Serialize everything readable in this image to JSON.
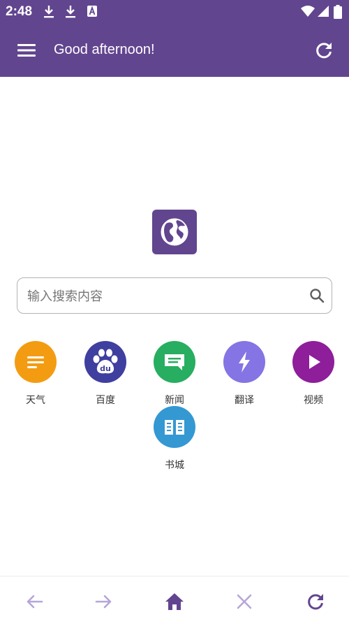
{
  "status_bar": {
    "time": "2:48",
    "icons": [
      "download-icon",
      "download-icon",
      "translate-a-icon",
      "wifi-icon",
      "signal-icon",
      "battery-icon"
    ]
  },
  "toolbar": {
    "title": "Good afternoon!",
    "menu_icon": "hamburger-menu-icon",
    "refresh_icon": "refresh-icon"
  },
  "logo": {
    "icon": "globe-icon"
  },
  "search": {
    "placeholder": "输入搜索内容",
    "value": "",
    "icon": "search-icon"
  },
  "shortcuts": [
    {
      "label": "天气",
      "color": "#f39c12",
      "icon": "lines-icon"
    },
    {
      "label": "百度",
      "color": "#3f3fa0",
      "icon": "baidu-paw-icon"
    },
    {
      "label": "新闻",
      "color": "#27ae60",
      "icon": "message-icon"
    },
    {
      "label": "翻译",
      "color": "#8474e4",
      "icon": "bolt-icon"
    },
    {
      "label": "视频",
      "color": "#8e1e9a",
      "icon": "play-icon"
    },
    {
      "label": "书城",
      "color": "#3498d2",
      "icon": "book-icon"
    }
  ],
  "bottom_nav": [
    {
      "name": "back",
      "icon": "arrow-left-icon"
    },
    {
      "name": "forward",
      "icon": "arrow-right-icon"
    },
    {
      "name": "home",
      "icon": "home-icon"
    },
    {
      "name": "close",
      "icon": "close-icon"
    },
    {
      "name": "refresh",
      "icon": "refresh-icon"
    }
  ],
  "colors": {
    "primary": "#62458f",
    "nav_inactive": "#b6a6d8",
    "nav_active": "#62458f"
  }
}
